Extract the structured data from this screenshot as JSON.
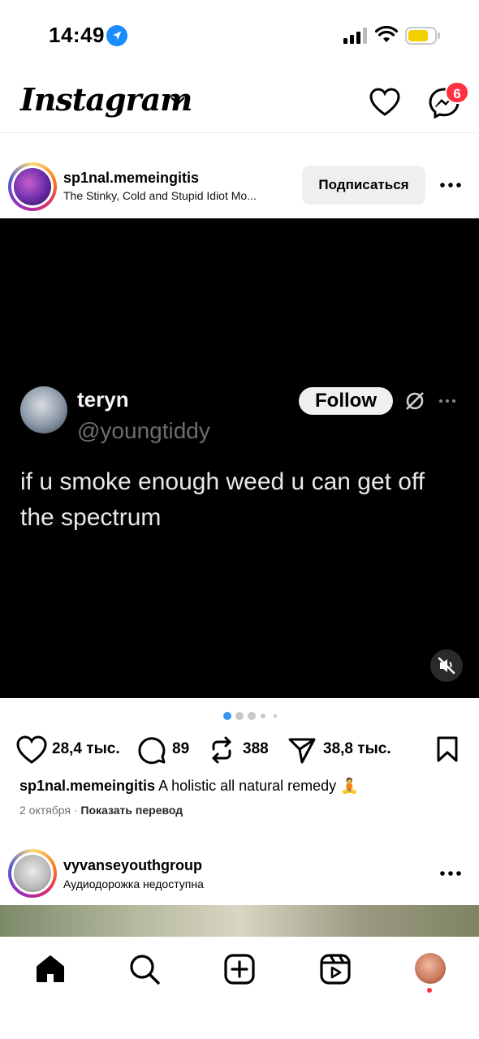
{
  "status_bar": {
    "time": "14:49",
    "icons": [
      "location-arrow-icon",
      "signal-icon",
      "wifi-icon",
      "battery-icon"
    ],
    "battery_color": "#f5d000"
  },
  "header": {
    "logo": "Instagram",
    "notifications_badge": "6",
    "badge_color": "#ff3040"
  },
  "post": {
    "username": "sp1nal.memeingitis",
    "subtitle": "The Stinky, Cold and Stupid Idiot Mo...",
    "follow_label": "Подписаться",
    "tweet": {
      "name": "teryn",
      "handle": "@youngtiddy",
      "follow_label": "Follow",
      "text": "if u smoke enough weed u can get off the spectrum"
    },
    "carousel": {
      "count": 5,
      "active": 0,
      "active_color": "#3897f0"
    },
    "likes": "28,4 тыс.",
    "comments": "89",
    "reposts": "388",
    "shares": "38,8 тыс.",
    "caption_user": "sp1nal.memeingitis",
    "caption_text": "A holistic all natural remedy 🧘",
    "date": "2 октября",
    "separator": "·",
    "translate_label": "Показать перевод"
  },
  "post2": {
    "username": "vyvanseyouthgroup",
    "subtitle": "Аудиодорожка недоступна"
  },
  "bottom_nav": {
    "items": [
      "home-icon",
      "search-icon",
      "create-icon",
      "reels-icon",
      "profile-avatar"
    ]
  }
}
